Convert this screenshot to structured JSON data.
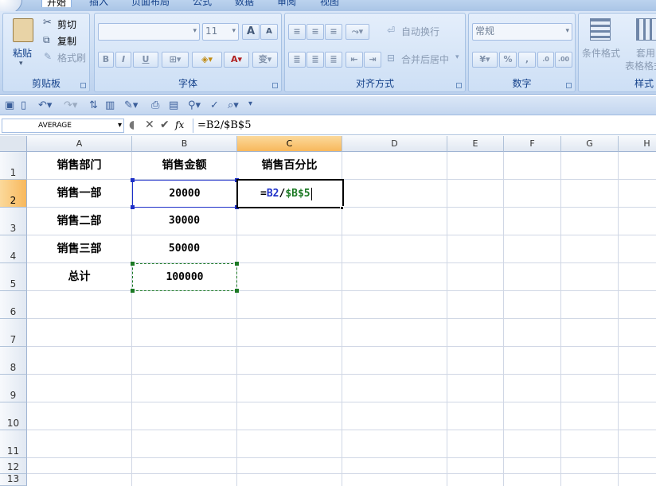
{
  "tabs": [
    "开始",
    "插入",
    "页面布局",
    "公式",
    "数据",
    "审阅",
    "视图"
  ],
  "ribbon": {
    "clipboard": {
      "paste": "粘贴",
      "cut": "剪切",
      "copy": "复制",
      "format_painter": "格式刷",
      "label": "剪贴板"
    },
    "font": {
      "size": "11",
      "bold": "B",
      "italic": "I",
      "underline": "U",
      "grow": "A",
      "shrink": "A",
      "label": "字体"
    },
    "alignment": {
      "wrap_text": "自动换行",
      "merge_center": "合并后居中",
      "label": "对齐方式"
    },
    "number": {
      "format": "常规",
      "percent": "%",
      "comma": ",",
      "inc_decimal": ".0",
      "dec_decimal": ".00",
      "label": "数字"
    },
    "styles": {
      "conditional": "条件格式",
      "table_line1": "套用",
      "table_line2": "表格格式",
      "label": "样式"
    }
  },
  "name_box": "AVERAGE",
  "formula_bar": {
    "fx": "fx",
    "value": "=B2/$B$5"
  },
  "columns": [
    "A",
    "B",
    "C",
    "D",
    "E",
    "F",
    "G",
    "H"
  ],
  "rows": [
    "1",
    "2",
    "3",
    "4",
    "5",
    "6",
    "7",
    "8",
    "9",
    "10",
    "11",
    "12",
    "13"
  ],
  "cells": {
    "A1": "销售部门",
    "B1": "销售金额",
    "C1": "销售百分比",
    "A2": "销售一部",
    "B2": "20000",
    "A3": "销售二部",
    "B3": "30000",
    "A4": "销售三部",
    "B4": "50000",
    "A5": "总计",
    "B5": "100000"
  },
  "editing": {
    "prefix": "=",
    "ref1": "B2",
    "op": "/",
    "ref2": "$B$5"
  },
  "colors": {
    "ref_blue": "#1e30c8",
    "ref_green": "#1c7a24",
    "active_header": "#f8b85c"
  }
}
